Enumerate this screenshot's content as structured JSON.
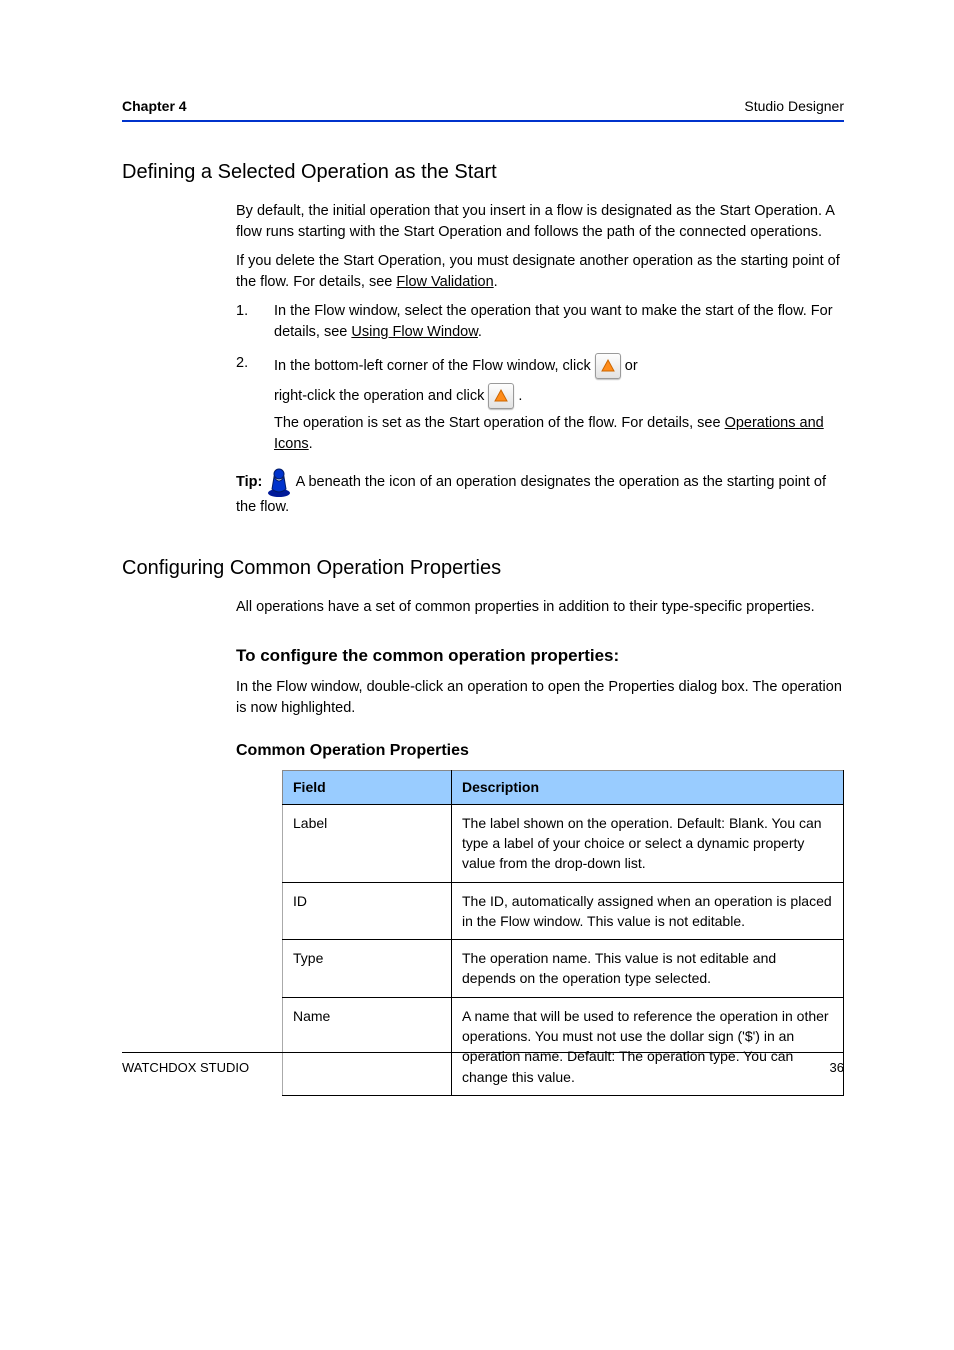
{
  "header": {
    "chapter": "Chapter 4",
    "title": "Studio Designer"
  },
  "s1": {
    "title": "Defining a Selected Operation as the Start",
    "intro": "By default, the initial operation that you insert in a flow is designated as the Start Operation. A flow runs starting with the Start Operation and follows the path of the connected operations.",
    "intro2": "If you delete the Start Operation, you must designate another operation as the starting point of the flow. For details, see ",
    "intro2_link": "Flow Validation",
    "intro2_tail": ".",
    "step1": {
      "num": "1.",
      "text": "In the Flow window, select the operation that you want to make the start of the flow. For details, see ",
      "link": "Using Flow Window",
      "tail": "."
    },
    "step2": {
      "num": "2.",
      "line1_a": "In the bottom-left corner of the Flow window, click ",
      "line1_b": " or ",
      "line2_a": "right-click the operation and click ",
      "line2_b": ".",
      "note_a": "The operation is set as the Start operation of the flow. For details, see ",
      "note_link": "Operations and Icons",
      "note_tail": "."
    },
    "tip_label": "Tip: ",
    "tip_text": "A  beneath the icon of an operation designates the operation as the starting point of the flow."
  },
  "s2": {
    "title": "Configuring Common Operation Properties",
    "intro": "All operations have a set of common properties in addition to their type-specific properties.",
    "tocfg": "To configure the common operation properties:",
    "before": "In the Flow window, double-click an operation to open the Properties dialog box. The operation is now highlighted.",
    "h4": "Common Operation Properties",
    "rows": [
      {
        "field": "Label",
        "desc": "The label shown on the operation. Default: Blank. You can type a label of your choice or select a dynamic property value from the drop-down list."
      },
      {
        "field": "ID",
        "desc": "The ID, automatically assigned when an operation is placed in the Flow window. This value is not editable."
      },
      {
        "field": "Type",
        "desc": "The operation name. This value is not editable and depends on the operation type selected."
      },
      {
        "field": "Name",
        "desc": "A name that will be used to reference the operation in other operations. You must not use the dollar sign ('$') in an operation name. Default: The operation type. You can change this value."
      }
    ],
    "theaders": {
      "field": "Field",
      "desc": "Description"
    }
  },
  "footer": {
    "product": "WATCHDOX STUDIO",
    "page": "36"
  }
}
